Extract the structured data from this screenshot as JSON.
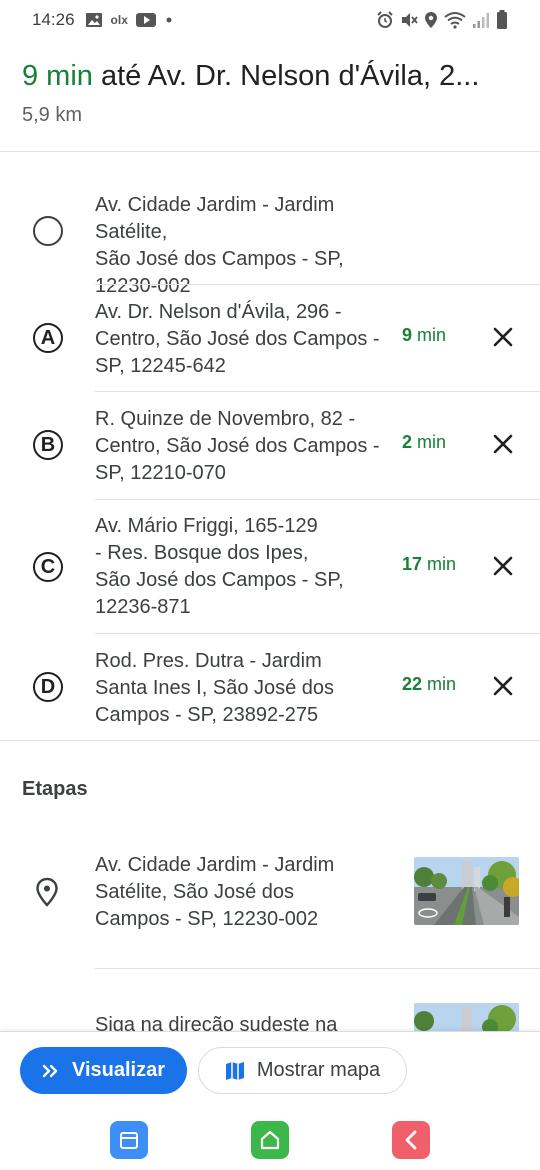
{
  "status_bar": {
    "time": "14:26",
    "left_icons": [
      "gallery-icon",
      "olx-icon",
      "youtube-icon",
      "dot-icon"
    ],
    "olx_label": "olx",
    "right_icons": [
      "alarm-icon",
      "mute-icon",
      "location-icon",
      "wifi-icon",
      "signal-icon",
      "battery-icon"
    ]
  },
  "header": {
    "duration": "9 min",
    "destination": " até Av. Dr. Nelson d'Ávila, 2...",
    "distance": "5,9 km"
  },
  "stops": [
    {
      "marker": "",
      "lines": [
        "Av. Cidade Jardim - Jardim Satélite,",
        "São José dos Campos - SP,",
        "12230-002"
      ],
      "eta_prefix": "",
      "eta_num": "",
      "eta_unit": "",
      "removable": false
    },
    {
      "marker": "A",
      "lines": [
        "Av. Dr. Nelson d'Ávila, 296 -",
        "Centro, São José dos Campos -",
        "SP, 12245-642"
      ],
      "eta_prefix": "",
      "eta_num": "9",
      "eta_unit": " min",
      "removable": true
    },
    {
      "marker": "B",
      "lines": [
        "R. Quinze de Novembro, 82 -",
        "Centro, São José dos Campos -",
        "SP, 12210-070"
      ],
      "eta_prefix": "",
      "eta_num": "2",
      "eta_unit": " min",
      "removable": true
    },
    {
      "marker": "C",
      "lines": [
        "Av. Mário Friggi, 165-129",
        "- Res. Bosque dos Ipes,",
        "São José dos Campos - SP,",
        "12236-871"
      ],
      "eta_prefix": "",
      "eta_num": "17",
      "eta_unit": " min",
      "removable": true
    },
    {
      "marker": "D",
      "lines": [
        "Rod. Pres. Dutra - Jardim",
        "Santa Ines I, São José dos",
        "Campos - SP, 23892-275"
      ],
      "eta_prefix": "",
      "eta_num": "22",
      "eta_unit": " min",
      "removable": true
    }
  ],
  "steps_section": {
    "title": "Etapas",
    "steps": [
      {
        "lines": [
          "Av. Cidade Jardim - Jardim",
          "Satélite, São José dos",
          "Campos - SP, 12230-002"
        ],
        "icon": "location-pin-icon"
      },
      {
        "lines": [
          "Siga na direção sudeste na"
        ],
        "icon": "direction-icon"
      }
    ]
  },
  "actions": {
    "preview_label": "Visualizar",
    "show_map_label": "Mostrar mapa"
  },
  "colors": {
    "accent_green": "#188038",
    "primary_blue": "#1a73e8"
  }
}
